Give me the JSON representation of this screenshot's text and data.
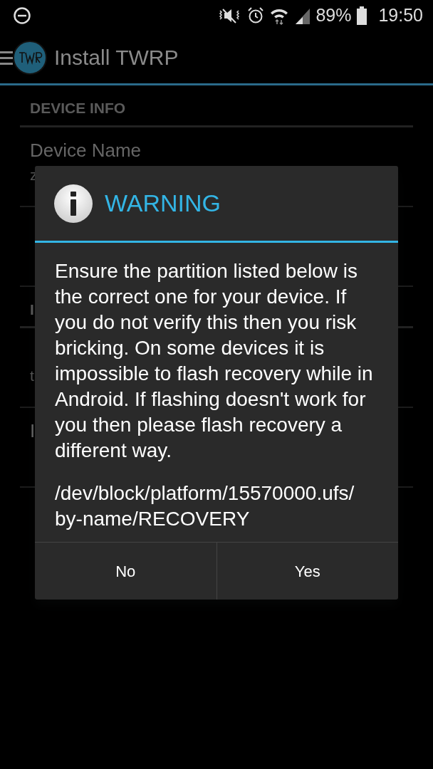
{
  "status_bar": {
    "battery_text": "89%",
    "time": "19:50"
  },
  "toolbar": {
    "title": "Install TWRP"
  },
  "sections": [
    {
      "header": "DEVICE INFO",
      "rows": [
        {
          "title": "Device Name",
          "value": "z"
        },
        {}
      ]
    },
    {
      "header": "I",
      "rows": [
        {
          "value": "t"
        },
        {
          "title": "I"
        }
      ]
    }
  ],
  "dialog": {
    "title": "WARNING",
    "message": "Ensure the partition listed below is the correct one for your device. If you do not verify this then you risk bricking. On some devices it is impossible to flash recovery while in Android. If flashing doesn't work for you then please flash recovery a different way.",
    "path": "/dev/block/platform/15570000.ufs/by-name/RECOVERY",
    "buttons": [
      "No",
      "Yes"
    ]
  }
}
